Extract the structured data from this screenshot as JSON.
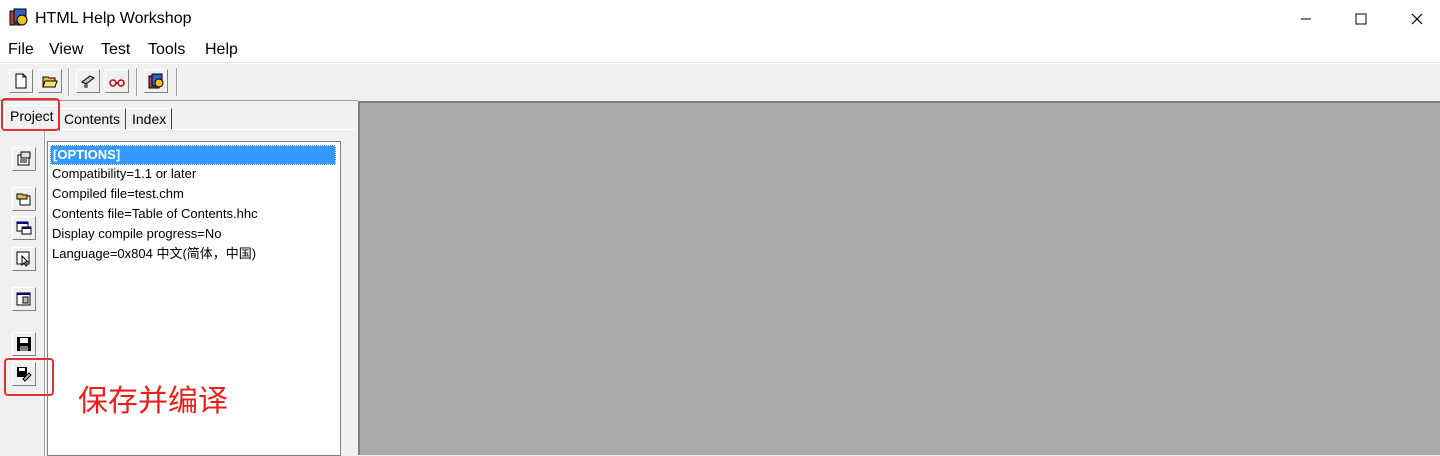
{
  "window": {
    "title": "HTML Help Workshop",
    "controls": {
      "minimize_icon": "minimize-icon",
      "maximize_icon": "maximize-icon",
      "close_icon": "close-icon"
    }
  },
  "menu": [
    {
      "label": "File"
    },
    {
      "label": "View"
    },
    {
      "label": "Test"
    },
    {
      "label": "Tools"
    },
    {
      "label": "Help"
    }
  ],
  "toolbar": {
    "buttons": [
      "new-file-icon",
      "open-folder-icon",
      "compile-icon",
      "view-compiled-icon",
      "help-icon"
    ]
  },
  "tabs": [
    {
      "label": "Project",
      "active": true
    },
    {
      "label": "Contents",
      "active": false
    },
    {
      "label": "Index",
      "active": false
    }
  ],
  "side_buttons": [
    "change-options-icon",
    "add-remove-files-icon",
    "window-definitions-icon",
    "api-information-icon",
    "html-file-icon",
    "save-project-icon",
    "save-and-compile-icon"
  ],
  "project_list": [
    "[OPTIONS]",
    "Compatibility=1.1 or later",
    "Compiled file=test.chm",
    "Contents file=Table of Contents.hhc",
    "Display compile progress=No",
    "Language=0x804 中文(简体，中国)"
  ],
  "annotation": "保存并编译",
  "colors": {
    "highlight": "#e03030",
    "selection": "#3399ff",
    "mdi_background": "#ababab"
  }
}
